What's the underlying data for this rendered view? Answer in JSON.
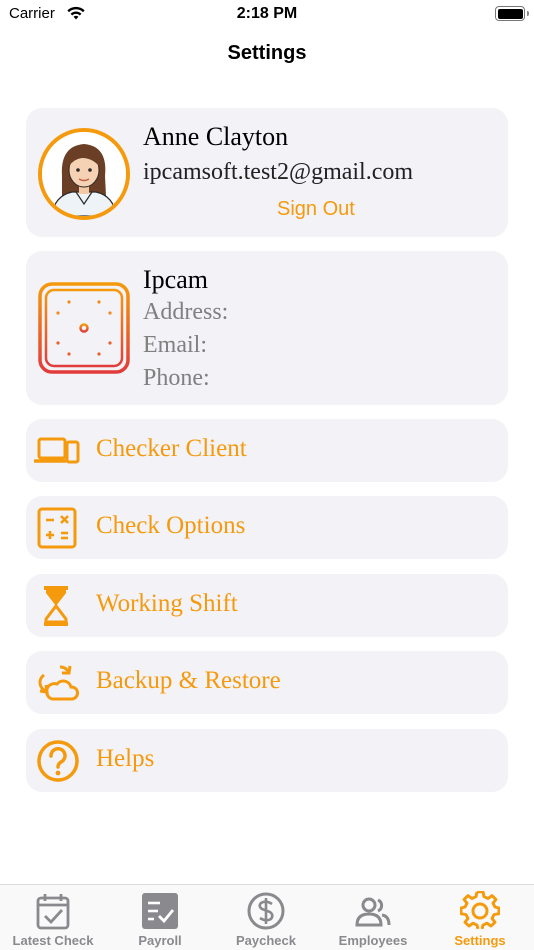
{
  "status_bar": {
    "carrier": "Carrier",
    "time": "2:18 PM"
  },
  "header": {
    "title": "Settings"
  },
  "profile": {
    "name": "Anne Clayton",
    "email": "ipcamsoft.test2@gmail.com",
    "sign_out_label": "Sign Out"
  },
  "company": {
    "name": "Ipcam",
    "address_label": "Address:",
    "email_label": "Email:",
    "phone_label": "Phone:"
  },
  "menu": [
    {
      "label": "Checker Client",
      "icon": "devices-icon"
    },
    {
      "label": "Check Options",
      "icon": "calculator-icon"
    },
    {
      "label": "Working Shift",
      "icon": "hourglass-icon"
    },
    {
      "label": "Backup & Restore",
      "icon": "cloud-sync-icon"
    },
    {
      "label": "Helps",
      "icon": "help-circle-icon"
    }
  ],
  "tabs": [
    {
      "label": "Latest Check",
      "icon": "calendar-check-icon",
      "active": false
    },
    {
      "label": "Payroll",
      "icon": "clipboard-check-icon",
      "active": false
    },
    {
      "label": "Paycheck",
      "icon": "dollar-circle-icon",
      "active": false
    },
    {
      "label": "Employees",
      "icon": "people-icon",
      "active": false
    },
    {
      "label": "Settings",
      "icon": "gear-icon",
      "active": true
    }
  ],
  "colors": {
    "accent": "#f59a0c",
    "card_bg": "#f2f2f7",
    "inactive": "#8a8a8e"
  }
}
